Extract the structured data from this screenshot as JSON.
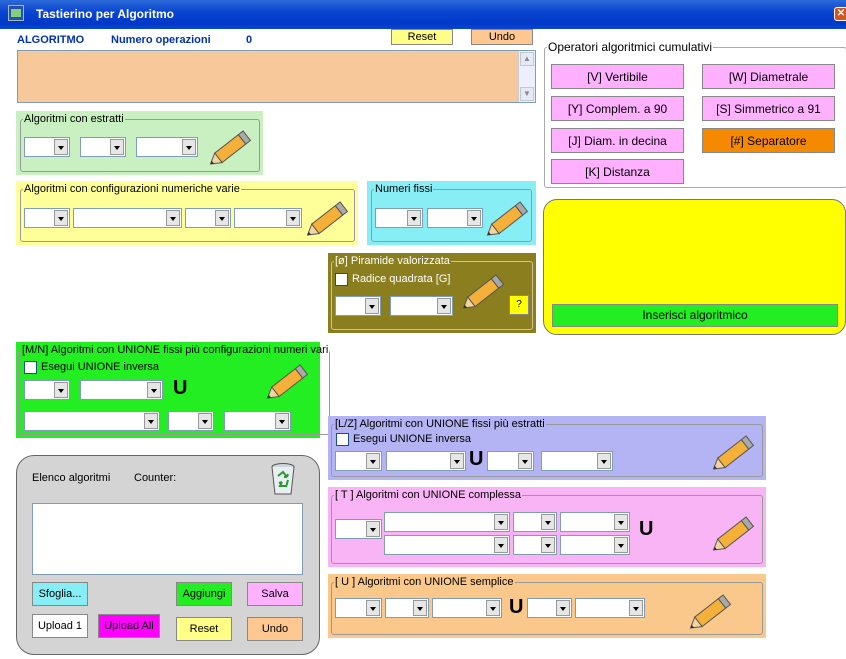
{
  "window": {
    "title": "Tastierino per Algoritmo",
    "close": "✕"
  },
  "header": {
    "algoritmo_label": "ALGORITMO",
    "numero_label": "Numero operazioni",
    "numero_value": "0",
    "reset": "Reset",
    "undo": "Undo"
  },
  "operatori": {
    "title": "Operatori algoritmici cumulativi",
    "v": "[V] Vertibile",
    "w": "[W] Diametrale",
    "y": "[Y] Complem. a 90",
    "s": "[S] Simmetrico  a 91",
    "j": "[J] Diam. in decina",
    "sep": "[#] Separatore",
    "k": "[K] Distanza"
  },
  "estratti": {
    "title": "Algoritmi con estratti"
  },
  "config": {
    "title": "Algoritmi con configurazioni numeriche varie"
  },
  "fissi": {
    "title": "Numeri fissi"
  },
  "piramide": {
    "title": "[ø] Piramide valorizzata",
    "radice": "Radice quadrata  [G]",
    "help": "?"
  },
  "inserisci": {
    "label": "Inserisci algoritmico"
  },
  "mn": {
    "title": "[M/N] Algoritmi con UNIONE fissi più configurazioni numeri vari",
    "inversa": "Esegui UNIONE inversa",
    "u": "U"
  },
  "lz": {
    "title": "[L/Z] Algoritmi con UNIONE fissi più estratti",
    "inversa": "Esegui UNIONE inversa",
    "u": "U"
  },
  "t": {
    "title": "[ T ] Algoritmi con UNIONE complessa",
    "u": "U"
  },
  "us": {
    "title": "[ U ] Algoritmi con UNIONE semplice",
    "u": "U"
  },
  "elenco": {
    "title": "Elenco algoritmi",
    "counter": "Counter:",
    "sfoglia": "Sfoglia...",
    "aggiungi": "Aggiungi",
    "salva": "Salva",
    "upload1": "Upload 1",
    "uploadall": "Upload All",
    "reset": "Reset",
    "undo": "Undo"
  },
  "colors": {
    "titlebar": "#0a46d1",
    "header_blue": "#0033aa",
    "orange_ta": "#f6c89a",
    "yellow_panel": "#ffff00",
    "green_btn": "#22ee22"
  }
}
